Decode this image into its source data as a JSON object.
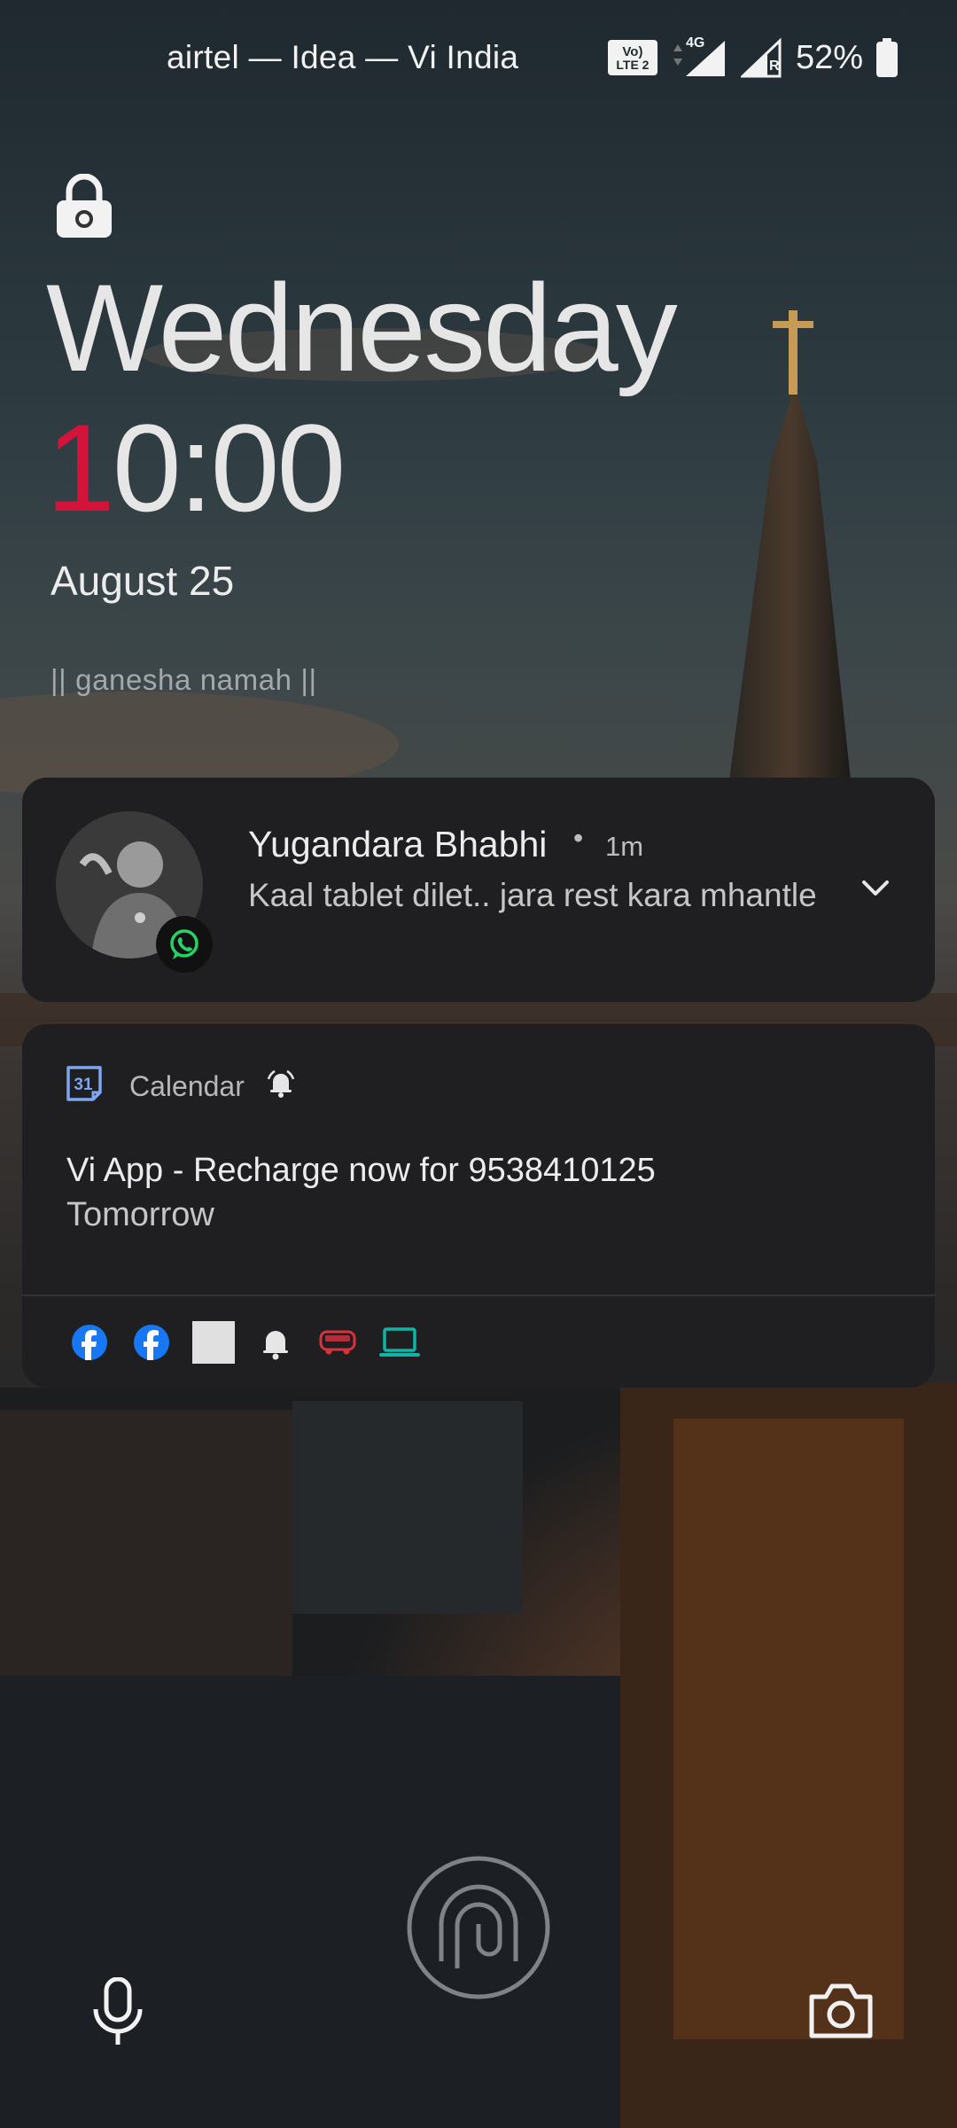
{
  "status_bar": {
    "carrier": "airtel — Idea — Vi India",
    "volte_label_top": "Vo)",
    "volte_label_bottom": "LTE 2",
    "network_type": "4G",
    "roaming_mark": "R",
    "battery_percent": "52%"
  },
  "lockscreen": {
    "day": "Wednesday",
    "time_first_digit": "1",
    "time_rest": "0:00",
    "date": "August 25",
    "custom_message": "|| ganesha namah ||"
  },
  "notifications": [
    {
      "app_icon": "whatsapp-icon",
      "sender": "Yugandara Bhabhi",
      "separator": "•",
      "age": "1m",
      "message": "Kaal tablet dilet.. jara rest kara mhantle"
    },
    {
      "app_icon": "calendar-icon",
      "app_name": "Calendar",
      "calendar_day": "31",
      "event_title": "Vi App - Recharge now for 9538410125",
      "event_when": "Tomorrow"
    }
  ],
  "notification_app_icons": [
    "facebook-icon",
    "facebook-icon",
    "blank-square-icon",
    "bell-icon",
    "redbus-icon",
    "laptop-icon"
  ],
  "colors": {
    "time_accent": "#d3133a",
    "card_bg": "#1f1f21",
    "whatsapp": "#25d366",
    "facebook": "#1877f2",
    "calendar_blue": "#7ea6f0",
    "redbus": "#d8323c",
    "teal": "#10b5a5"
  }
}
